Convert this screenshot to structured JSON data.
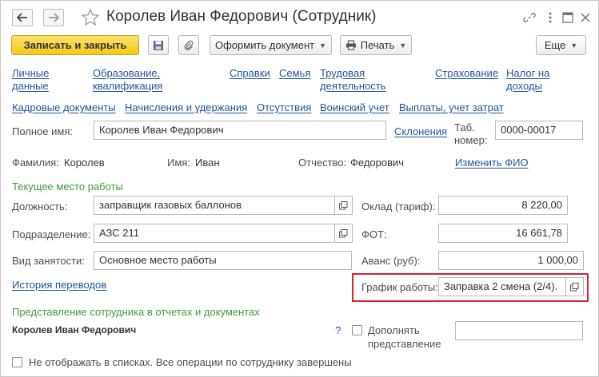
{
  "window": {
    "title": "Королев Иван Федорович (Сотрудник)"
  },
  "toolbar": {
    "save_close": "Записать и закрыть",
    "create_doc": "Оформить документ",
    "print": "Печать",
    "more": "Еще"
  },
  "nav_links": {
    "personal": "Личные\nданные",
    "education": "Образование,\nквалификация",
    "references": "Справки",
    "family": "Семья",
    "labor": "Трудовая\nдеятельность",
    "insurance": "Страхование",
    "tax": "Налог на\nдоходы",
    "hr_docs": "Кадровые документы",
    "accruals": "Начисления и удержания",
    "absences": "Отсутствия",
    "military": "Воинский учет",
    "payments": "Выплаты, учет затрат"
  },
  "form": {
    "full_name_label": "Полное имя:",
    "full_name_value": "Королев Иван Федорович",
    "declensions_link": "Склонения",
    "tab_number_label": "Таб.\nномер:",
    "tab_number_value": "0000-00017",
    "surname_label": "Фамилия:",
    "surname_value": "Королев",
    "name_label": "Имя:",
    "name_value": "Иван",
    "patronymic_label": "Отчество:",
    "patronymic_value": "Федорович",
    "change_fio_link": "Изменить ФИО",
    "current_job_section": "Текущее место работы",
    "position_label": "Должность:",
    "position_value": "заправщик газовых баллонов",
    "department_label": "Подразделение:",
    "department_value": "АЗС 211",
    "employment_label": "Вид занятости:",
    "employment_value": "Основное место работы",
    "salary_label": "Оклад (тариф):",
    "salary_value": "8 220,00",
    "fot_label": "ФОТ:",
    "fot_value": "16 661,78",
    "advance_label": "Аванс (руб):",
    "advance_value": "1 000,00",
    "transfer_history_link": "История переводов",
    "schedule_label": "График работы:",
    "schedule_value": "Заправка 2 смена (2/4).",
    "representation_section": "Представление сотрудника в отчетах и документах",
    "representation_name": "Королев Иван Федорович",
    "help_mark": "?",
    "supplement_label": "Дополнять\nпредставление",
    "supplement_value": "",
    "hide_in_lists_label": "Не отображать в списках. Все операции по сотруднику завершены"
  },
  "colors": {
    "link": "#1f55a0",
    "section": "#3a9f3a",
    "primary_button": "#f5c71a",
    "highlight": "#d8232a"
  },
  "icons": [
    "back-arrow-icon",
    "forward-arrow-icon",
    "star-icon",
    "link-icon",
    "more-vertical-icon",
    "maximize-icon",
    "close-icon",
    "save-icon",
    "attach-icon",
    "printer-icon",
    "open-icon"
  ]
}
